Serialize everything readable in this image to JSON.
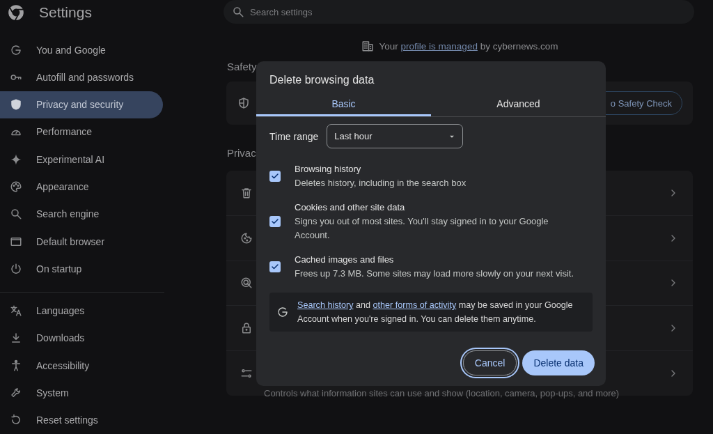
{
  "app": {
    "title": "Settings"
  },
  "search": {
    "placeholder": "Search settings"
  },
  "sidebar": {
    "groups": [
      [
        {
          "label": "You and Google",
          "selected": false
        },
        {
          "label": "Autofill and passwords",
          "selected": false
        },
        {
          "label": "Privacy and security",
          "selected": true
        },
        {
          "label": "Performance",
          "selected": false
        },
        {
          "label": "Experimental AI",
          "selected": false
        },
        {
          "label": "Appearance",
          "selected": false
        },
        {
          "label": "Search engine",
          "selected": false
        },
        {
          "label": "Default browser",
          "selected": false
        },
        {
          "label": "On startup",
          "selected": false
        }
      ],
      [
        {
          "label": "Languages",
          "selected": false
        },
        {
          "label": "Downloads",
          "selected": false
        },
        {
          "label": "Accessibility",
          "selected": false
        },
        {
          "label": "System",
          "selected": false
        },
        {
          "label": "Reset settings",
          "selected": false
        }
      ]
    ]
  },
  "managed_notice": {
    "before": "Your",
    "link": "profile is managed",
    "after": "by cybernews.com"
  },
  "safety_section": {
    "heading": "Safety",
    "button": "o Safety Check"
  },
  "privacy_section": {
    "heading": "Privac",
    "rows": [
      {
        "kind": "entry"
      },
      {
        "kind": "entry"
      },
      {
        "kind": "entry"
      },
      {
        "kind": "entry"
      },
      {
        "kind": "entry",
        "description": "Controls what information sites can use and show (location, camera, pop-ups, and more)"
      }
    ]
  },
  "dialog": {
    "title": "Delete browsing data",
    "tabs": [
      {
        "label": "Basic",
        "selected": true
      },
      {
        "label": "Advanced",
        "selected": false
      }
    ],
    "time_range": {
      "label": "Time range",
      "value": "Last hour"
    },
    "options": [
      {
        "title": "Browsing history",
        "description": "Deletes history, including in the search box",
        "checked": true
      },
      {
        "title": "Cookies and other site data",
        "description": "Signs you out of most sites. You'll stay signed in to your Google Account.",
        "checked": true
      },
      {
        "title": "Cached images and files",
        "description": "Frees up 7.3 MB. Some sites may load more slowly on your next visit.",
        "checked": true
      }
    ],
    "notice": {
      "segments": [
        {
          "text": "Search history",
          "kind": "link"
        },
        {
          "text": "and",
          "kind": "text"
        },
        {
          "text": "other forms of activity",
          "kind": "link"
        },
        {
          "text": "may be saved in your Google Account when you're signed in. You can delete them anytime.",
          "kind": "text"
        }
      ]
    },
    "buttons": [
      {
        "label": "Cancel",
        "kind": "secondary"
      },
      {
        "label": "Delete data",
        "kind": "primary"
      }
    ]
  }
}
